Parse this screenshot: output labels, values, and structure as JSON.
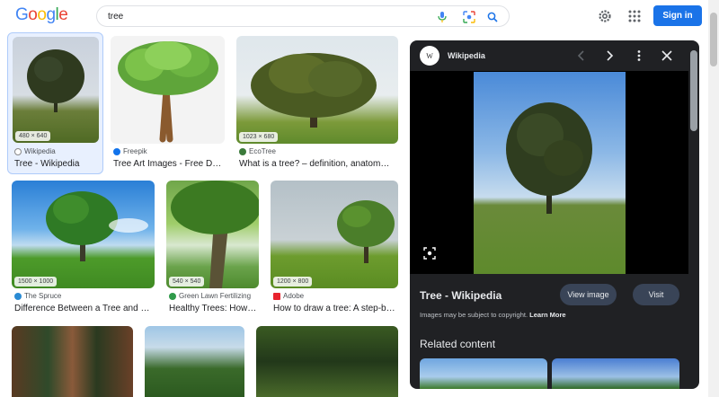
{
  "header": {
    "logo_letters": [
      {
        "ch": "G",
        "color": "#4285f4"
      },
      {
        "ch": "o",
        "color": "#ea4335"
      },
      {
        "ch": "o",
        "color": "#fbbc05"
      },
      {
        "ch": "g",
        "color": "#4285f4"
      },
      {
        "ch": "l",
        "color": "#34a853"
      },
      {
        "ch": "e",
        "color": "#ea4335"
      }
    ],
    "search_value": "tree",
    "signin_label": "Sign in"
  },
  "results": [
    {
      "dims": "480 × 640",
      "source": "Wikipedia",
      "title": "Tree - Wikipedia"
    },
    {
      "dims": "",
      "source": "Freepik",
      "title": "Tree Art Images - Free Do..."
    },
    {
      "dims": "1023 × 680",
      "source": "EcoTree",
      "title": "What is a tree? – definition, anatomy ..."
    },
    {
      "dims": "1500 × 1000",
      "source": "The Spruce",
      "title": "Difference Between a Tree and a ..."
    },
    {
      "dims": "540 × 540",
      "source": "Green Lawn Fertilizing",
      "title": "Healthy Trees: How t..."
    },
    {
      "dims": "1200 × 800",
      "source": "Adobe",
      "title": "How to draw a tree: A step-by-..."
    }
  ],
  "panel": {
    "source": "Wikipedia",
    "source_glyph": "W",
    "title": "Tree - Wikipedia",
    "view_image_label": "View image",
    "visit_label": "Visit",
    "copyright_text": "Images may be subject to copyright.",
    "learn_more_label": "Learn More",
    "related_heading": "Related content"
  },
  "colors": {
    "accent": "#1a73e8",
    "panel_bg": "#202124"
  }
}
